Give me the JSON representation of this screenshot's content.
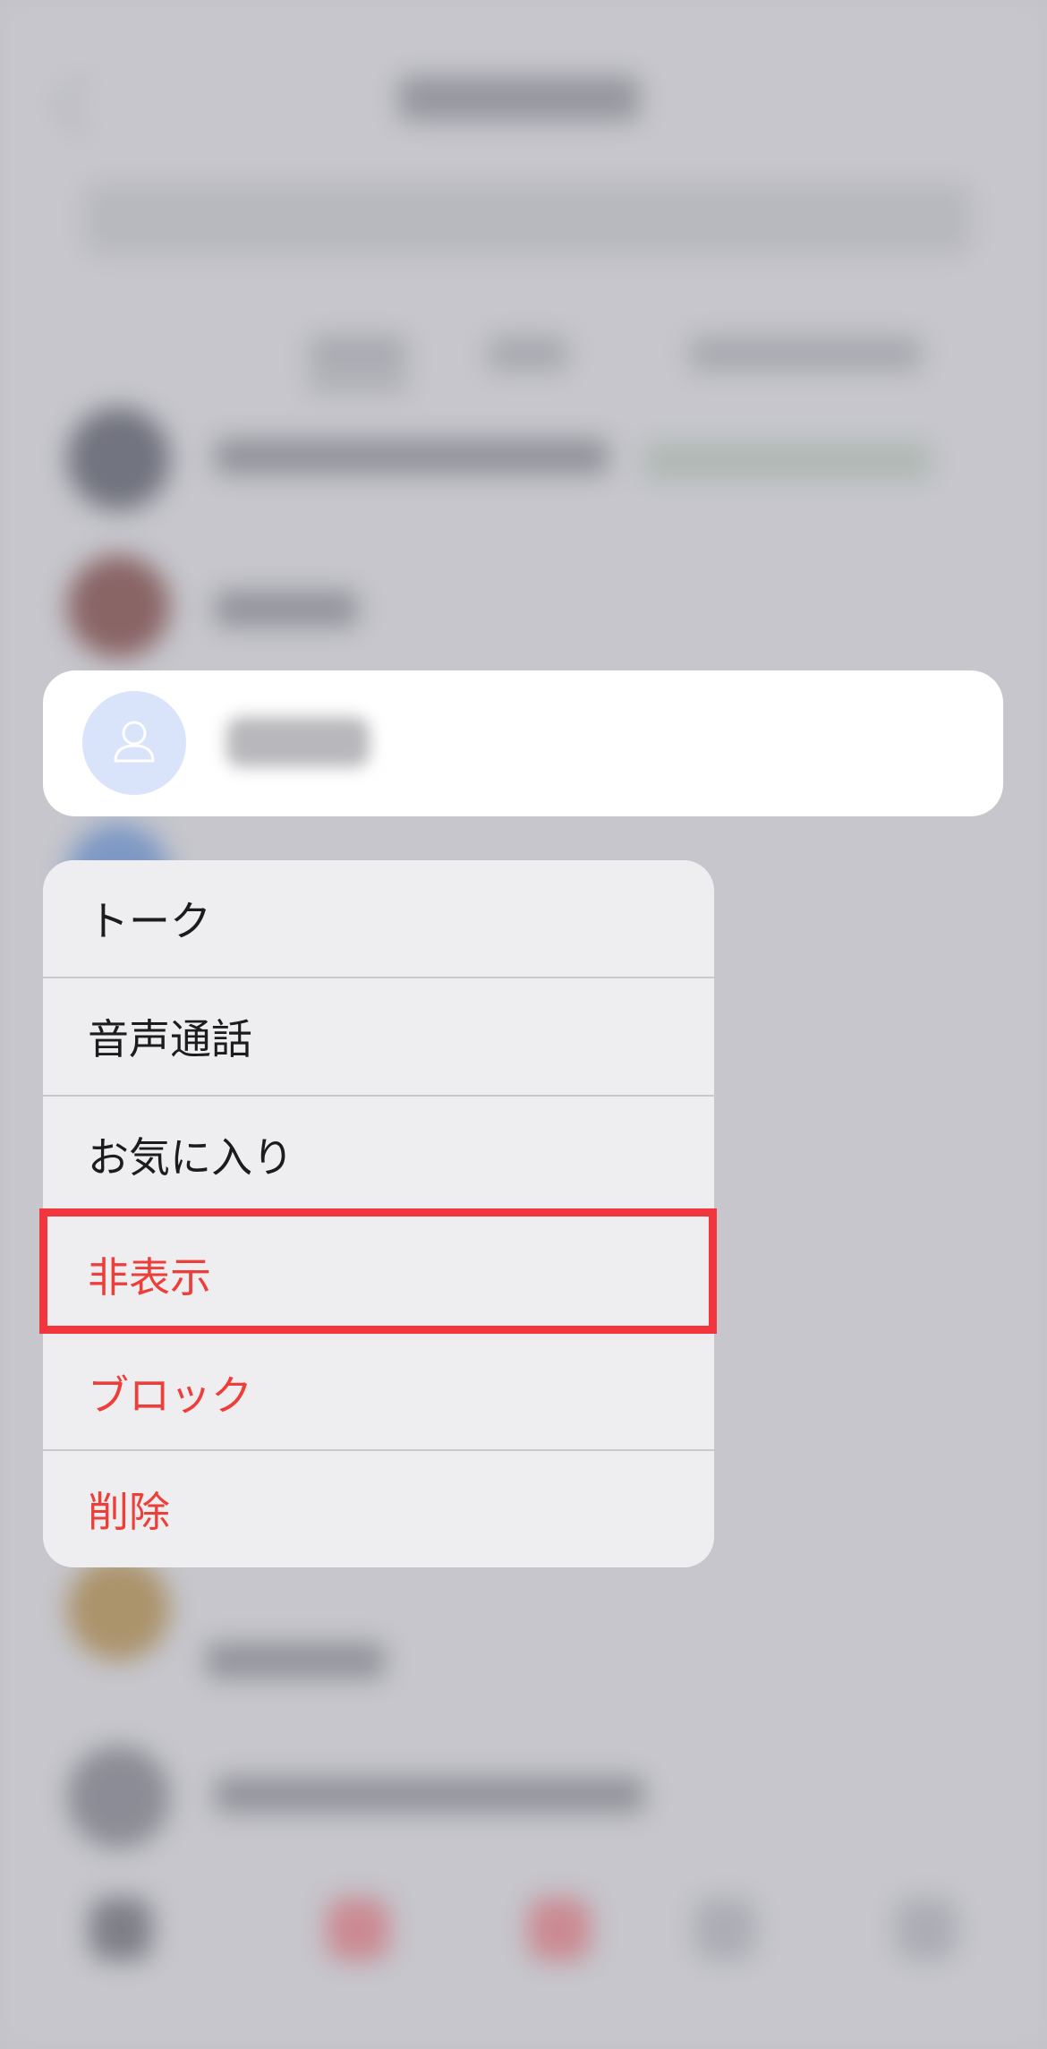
{
  "contact": {
    "avatar_icon": "person-outline-icon"
  },
  "menu": {
    "items": [
      {
        "label": "トーク",
        "style": "normal"
      },
      {
        "label": "音声通話",
        "style": "normal"
      },
      {
        "label": "お気に入り",
        "style": "normal"
      },
      {
        "label": "非表示",
        "style": "danger"
      },
      {
        "label": "ブロック",
        "style": "danger"
      },
      {
        "label": "削除",
        "style": "danger"
      }
    ]
  },
  "colors": {
    "danger_text": "#ee3e3a",
    "highlight_border": "#f2363d",
    "avatar_bg": "#d9e4fb",
    "menu_bg": "#eeeef0",
    "card_bg": "#ffffff"
  }
}
